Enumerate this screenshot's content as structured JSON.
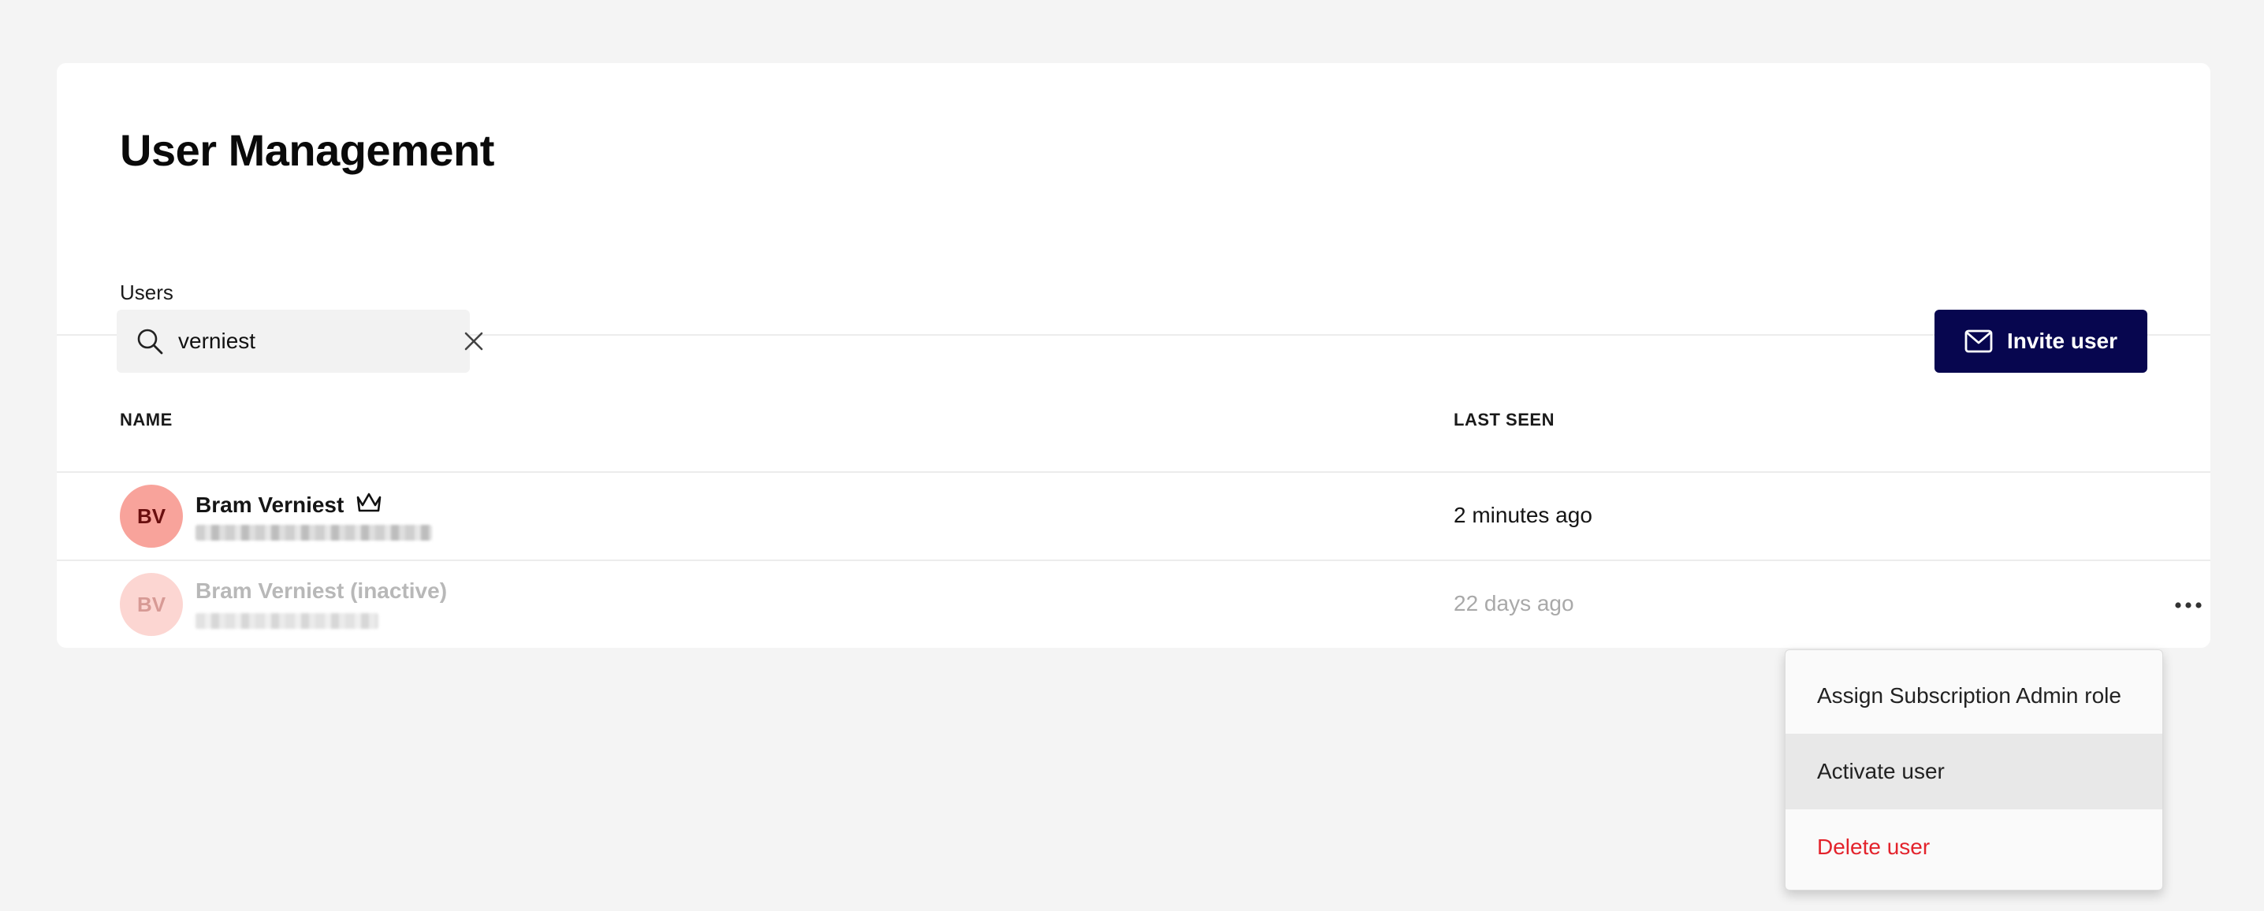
{
  "page": {
    "title": "User Management"
  },
  "tabs": [
    {
      "label": "Users",
      "active": true
    }
  ],
  "search": {
    "value": "verniest",
    "icon": "search-icon",
    "clear_icon": "close-icon"
  },
  "toolbar": {
    "invite_label": "Invite user",
    "invite_icon": "mail-icon",
    "invite_color": "#07064f"
  },
  "table": {
    "columns": [
      "NAME",
      "LAST SEEN"
    ],
    "rows": [
      {
        "initials": "BV",
        "name": "Bram Verniest",
        "badge_icon": "crown-icon",
        "last_seen": "2 minutes ago",
        "status": "active",
        "avatar_color": "#f8a39b"
      },
      {
        "initials": "BV",
        "name": "Bram Verniest (inactive)",
        "last_seen": "22 days ago",
        "status": "inactive",
        "avatar_color": "#fcd6d2"
      }
    ]
  },
  "context_menu": {
    "items": [
      {
        "label": "Assign Subscription Admin role"
      },
      {
        "label": "Activate user",
        "highlighted": true
      },
      {
        "label": "Delete user",
        "destructive": true,
        "color": "#e3232c"
      }
    ]
  }
}
